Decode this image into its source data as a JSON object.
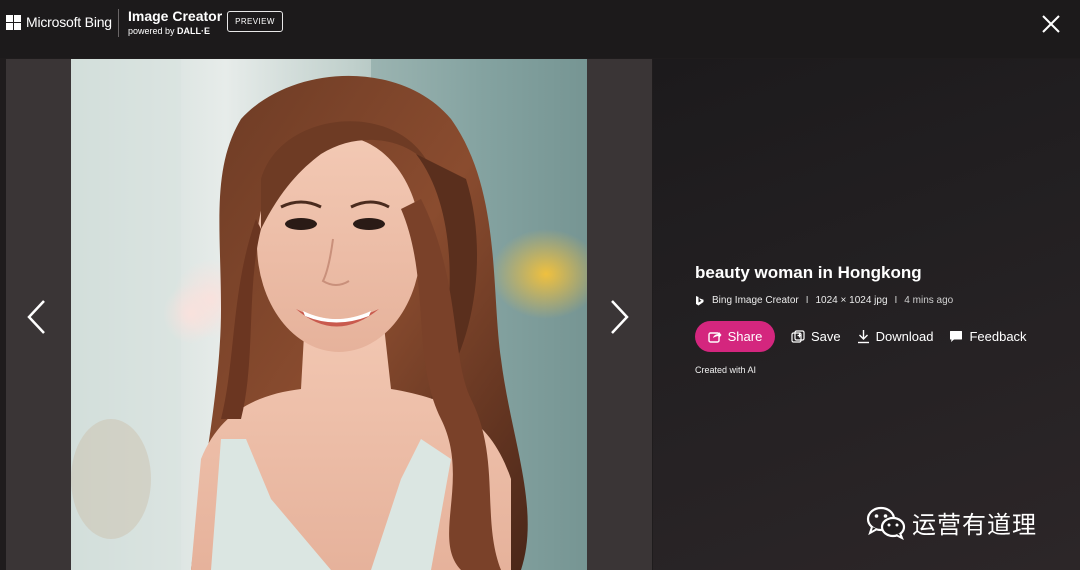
{
  "header": {
    "brand": "Microsoft Bing",
    "product_title": "Image Creator",
    "product_sub_prefix": "powered by",
    "product_sub_engine": "DALL·E",
    "badge": "PREVIEW"
  },
  "detail": {
    "title": "beauty woman in Hongkong",
    "source": "Bing Image Creator",
    "separator": "I",
    "dimensions": "1024 × 1024 jpg",
    "time": "4 mins ago",
    "created_note": "Created with AI"
  },
  "actions": {
    "share": "Share",
    "save": "Save",
    "download": "Download",
    "feedback": "Feedback"
  },
  "watermark": {
    "text": "运营有道理"
  },
  "colors": {
    "share_button": "#d4267e",
    "panel_bg": "#1f1c1d"
  },
  "icons": [
    "windows-logo-icon",
    "close-icon",
    "chevron-left-icon",
    "chevron-right-icon",
    "bing-logo-icon",
    "share-icon",
    "save-icon",
    "download-icon",
    "feedback-icon",
    "wechat-icon"
  ]
}
